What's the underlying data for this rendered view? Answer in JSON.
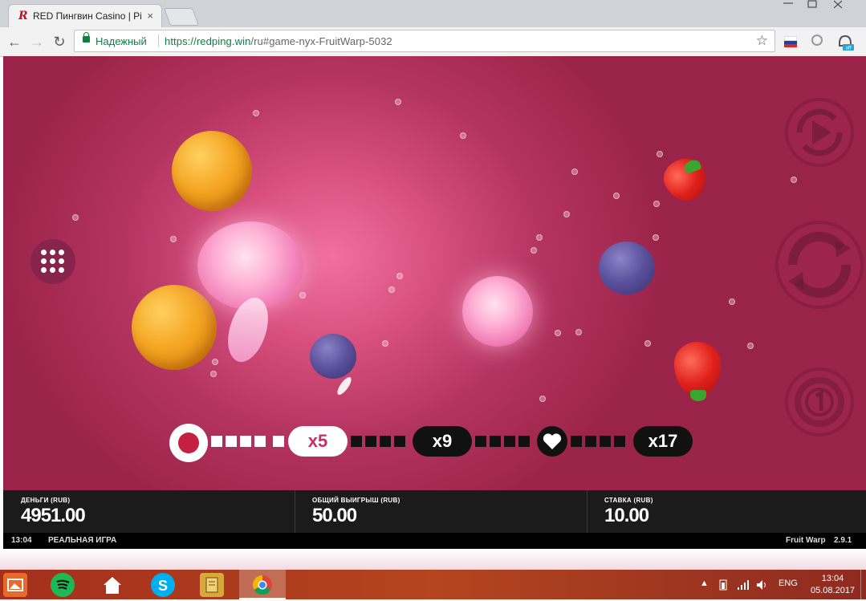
{
  "browser": {
    "tab_title": "RED Пингвин Casino | Pi",
    "tab_close": "×",
    "favicon_letter": "R",
    "security_label": "Надежный",
    "url_host": "https://redping.win",
    "url_rest": "/ru#game-nyx-FruitWarp-5032",
    "back_icon": "←",
    "forward_icon": "→",
    "reload_icon": "↻",
    "star_icon": "☆",
    "ext_off_badge": "off"
  },
  "game": {
    "multiplier_bar": {
      "nodes": [
        "x5",
        "x9",
        "x17"
      ],
      "active_node": "x5"
    },
    "side_buttons": [
      "autoplay-button",
      "spin-button",
      "bet-button"
    ]
  },
  "status": {
    "money_label": "ДЕНЬГИ (RUB)",
    "money_value": "4951.00",
    "total_win_label": "ОБЩИЙ ВЫИГРЫШ (RUB)",
    "total_win_value": "50.00",
    "bet_label": "СТАВКА (RUB)",
    "bet_value": "10.00"
  },
  "info_bar": {
    "time": "13:04",
    "mode": "РЕАЛЬНАЯ ИГРА",
    "game_name": "Fruit Warp",
    "version": "2.9.1"
  },
  "taskbar": {
    "language": "ENG",
    "clock_time": "13:04",
    "clock_date": "05.08.2017"
  },
  "colors": {
    "accent": "#c43068",
    "background": "#b43460",
    "status_bar": "#1b1b1b",
    "taskbar": "#a42f1c"
  }
}
